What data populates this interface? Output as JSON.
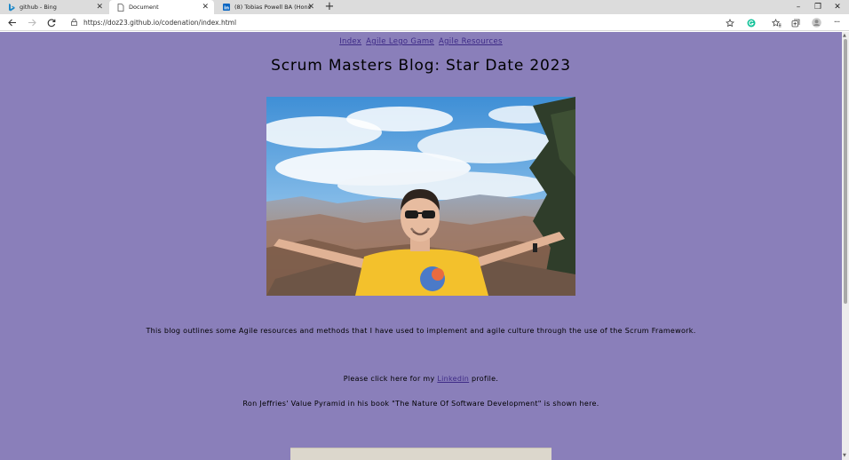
{
  "browser": {
    "tabs": [
      {
        "title": "github - Bing",
        "icon": "bing-icon",
        "active": false
      },
      {
        "title": "Document",
        "icon": "document-icon",
        "active": true
      },
      {
        "title": "(8) Tobias Powell BA (Hons), PMP",
        "icon": "linkedin-icon",
        "active": false
      }
    ],
    "url": "https://doz23.github.io/codenation/index.html"
  },
  "page": {
    "nav_links": [
      "Index",
      "Agile Lego Game",
      "Agile Resources"
    ],
    "title": "Scrum Masters Blog: Star Date 2023",
    "intro": "This blog outlines some Agile resources and methods that I have used to implement and agile culture through the use of the Scrum Framework.",
    "linkedin_before": "Please click here for my ",
    "linkedin_link": "Linkedin",
    "linkedin_after": " profile.",
    "pyramid_text": "Ron Jeffries' Value Pyramid in his book \"The Nature Of Software Development\" is shown here."
  },
  "colors": {
    "page_background": "#8a7fba",
    "link": "#3d2a86"
  }
}
